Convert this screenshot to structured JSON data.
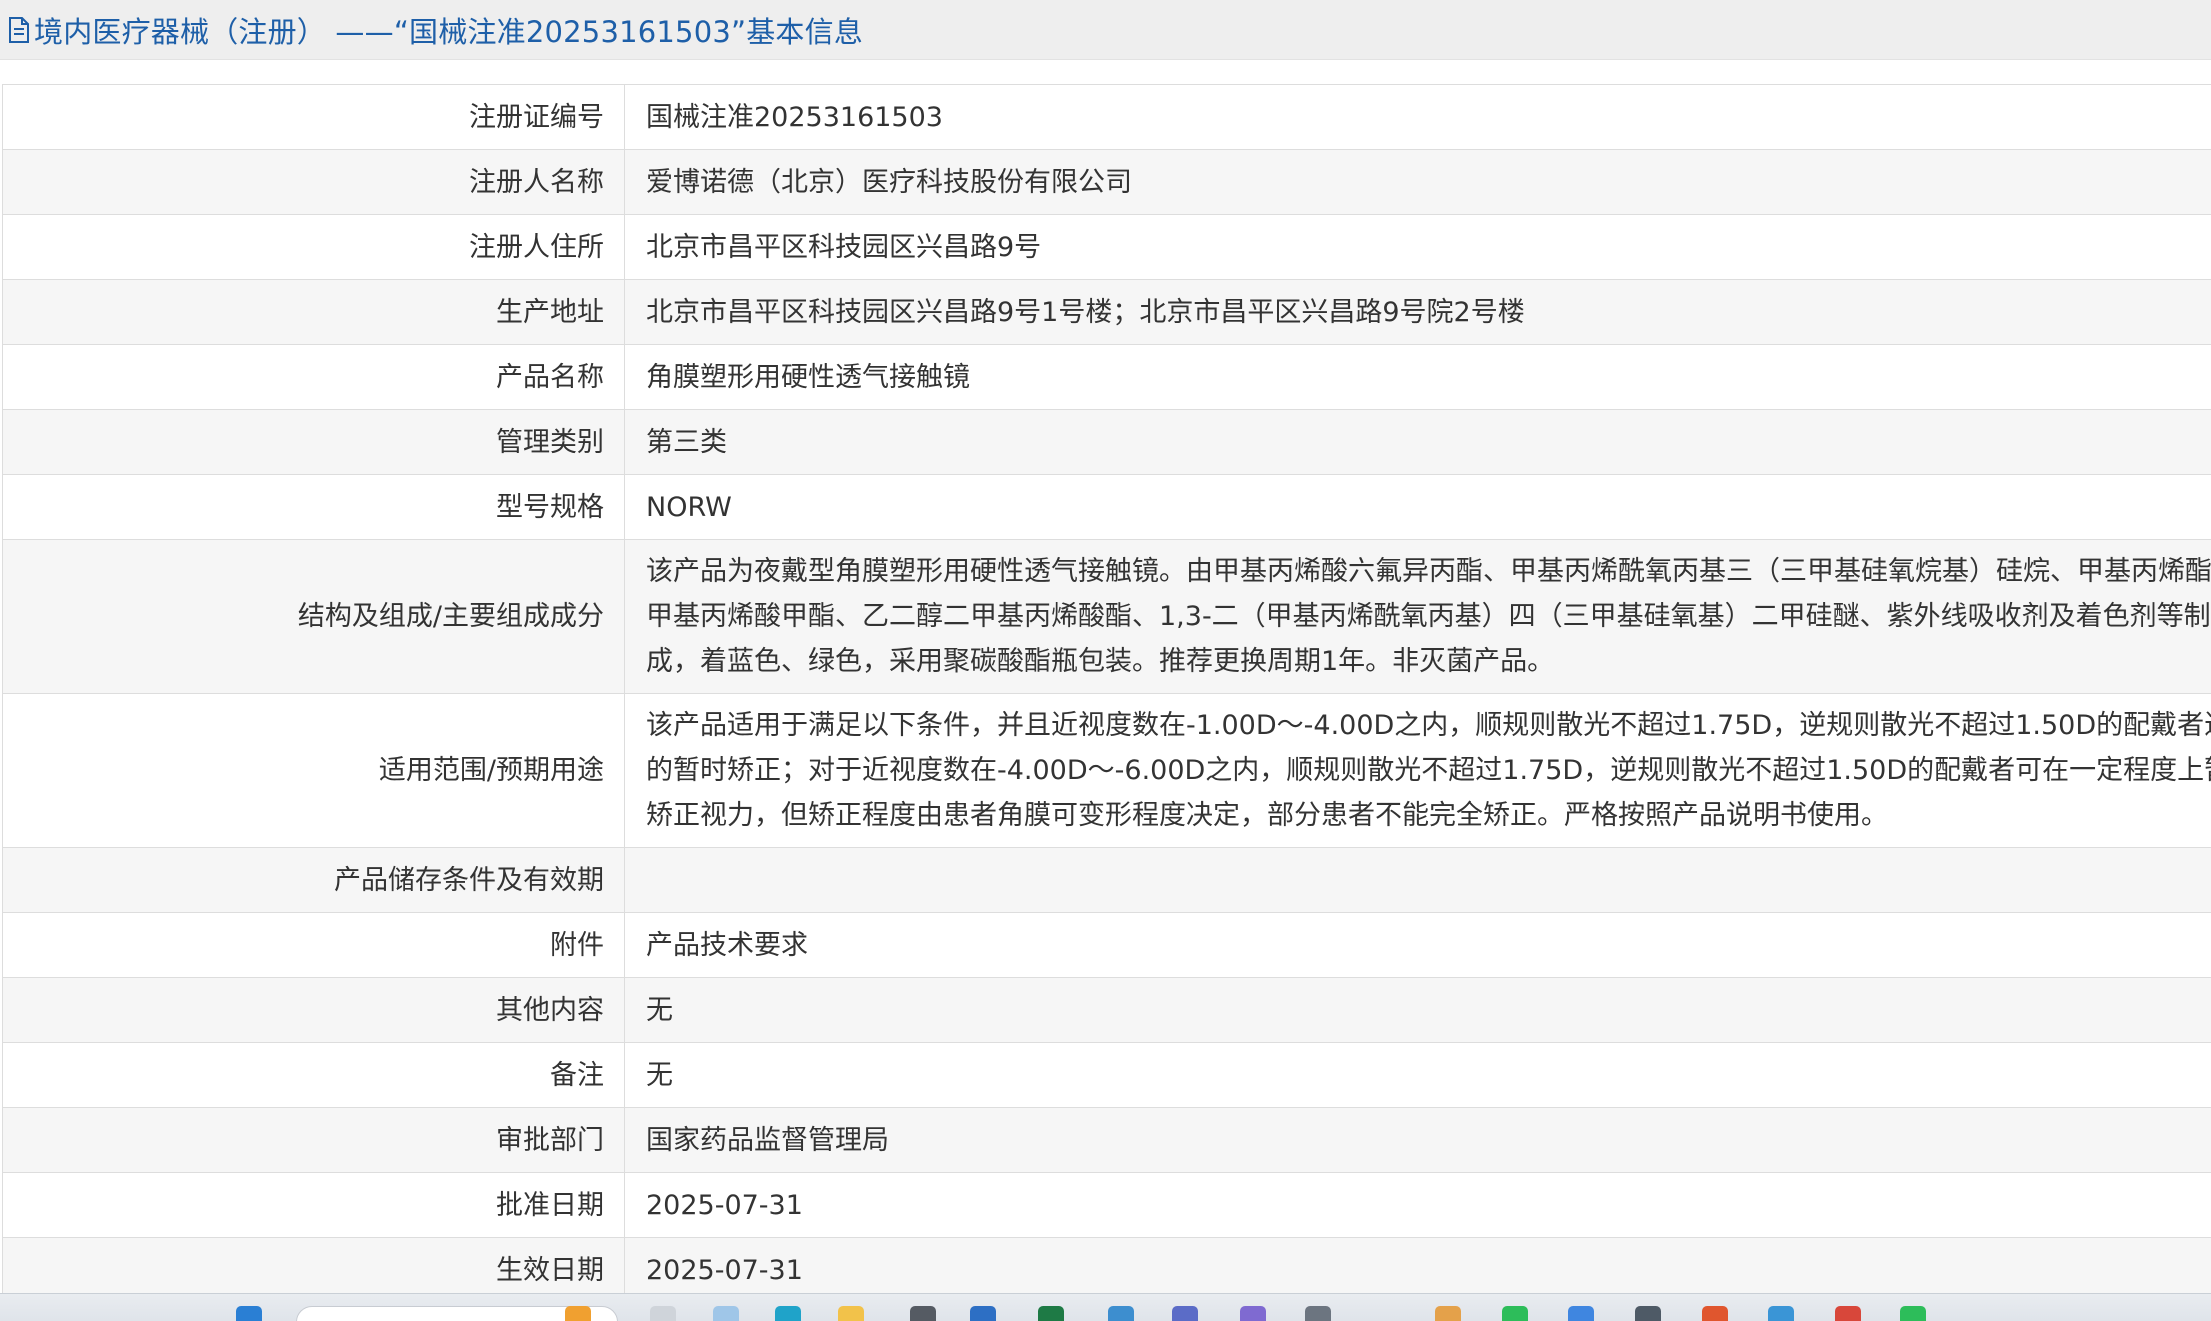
{
  "page_title": "境内医疗器械（注册） ——“国械注准20253161503”基本信息",
  "title_icon": "document-icon",
  "colors": {
    "title_text": "#1e5fa8",
    "header_bg": "#eeeeee",
    "row_alt_bg": "#f6f6f6",
    "border": "#dddddd"
  },
  "rows": [
    {
      "label": "注册证编号",
      "value": "国械注准20253161503"
    },
    {
      "label": "注册人名称",
      "value": "爱博诺德（北京）医疗科技股份有限公司"
    },
    {
      "label": "注册人住所",
      "value": "北京市昌平区科技园区兴昌路9号"
    },
    {
      "label": "生产地址",
      "value": "北京市昌平区科技园区兴昌路9号1号楼；北京市昌平区兴昌路9号院2号楼"
    },
    {
      "label": "产品名称",
      "value": "角膜塑形用硬性透气接触镜"
    },
    {
      "label": "管理类别",
      "value": "第三类"
    },
    {
      "label": "型号规格",
      "value": "NORW"
    },
    {
      "label": "结构及组成/主要组成成分",
      "lines": [
        "该产品为夜戴型角膜塑形用硬性透气接触镜。由甲基丙烯酸六氟异丙酯、甲基丙烯酰氧丙基三（三甲基硅氧烷基）硅烷、甲基丙烯酯",
        "甲基丙烯酸甲酯、乙二醇二甲基丙烯酸酯、1,3-二（甲基丙烯酰氧丙基）四（三甲基硅氧基）二甲硅醚、紫外线吸收剂及着色剂等制",
        "成，着蓝色、绿色，采用聚碳酸酯瓶包装。推荐更换周期1年。非灭菌产品。"
      ]
    },
    {
      "label": "适用范围/预期用途",
      "lines": [
        "该产品适用于满足以下条件，并且近视度数在-1.00D～-4.00D之内，顺规则散光不超过1.75D，逆规则散光不超过1.50D的配戴者近",
        "的暂时矫正；对于近视度数在-4.00D～-6.00D之内，顺规则散光不超过1.75D，逆规则散光不超过1.50D的配戴者可在一定程度上暂",
        "矫正视力，但矫正程度由患者角膜可变形程度决定，部分患者不能完全矫正。严格按照产品说明书使用。"
      ]
    },
    {
      "label": "产品储存条件及有效期",
      "value": ""
    },
    {
      "label": "附件",
      "value": "产品技术要求"
    },
    {
      "label": "其他内容",
      "value": "无"
    },
    {
      "label": "备注",
      "value": "无"
    },
    {
      "label": "审批部门",
      "value": "国家药品监督管理局"
    },
    {
      "label": "批准日期",
      "value": "2025-07-31"
    },
    {
      "label": "生效日期",
      "value": "2025-07-31"
    }
  ],
  "taskbar": {
    "search_placeholder": "",
    "icons": [
      "start-icon",
      "search-box",
      "browser-icon",
      "folder-icon",
      "store-icon",
      "mail-icon",
      "excel-icon",
      "app-icon",
      "app-icon",
      "app-icon",
      "app-icon",
      "folder-icon",
      "wechat-icon",
      "app-icon",
      "app-icon",
      "app-icon",
      "app-icon",
      "app-icon"
    ]
  }
}
